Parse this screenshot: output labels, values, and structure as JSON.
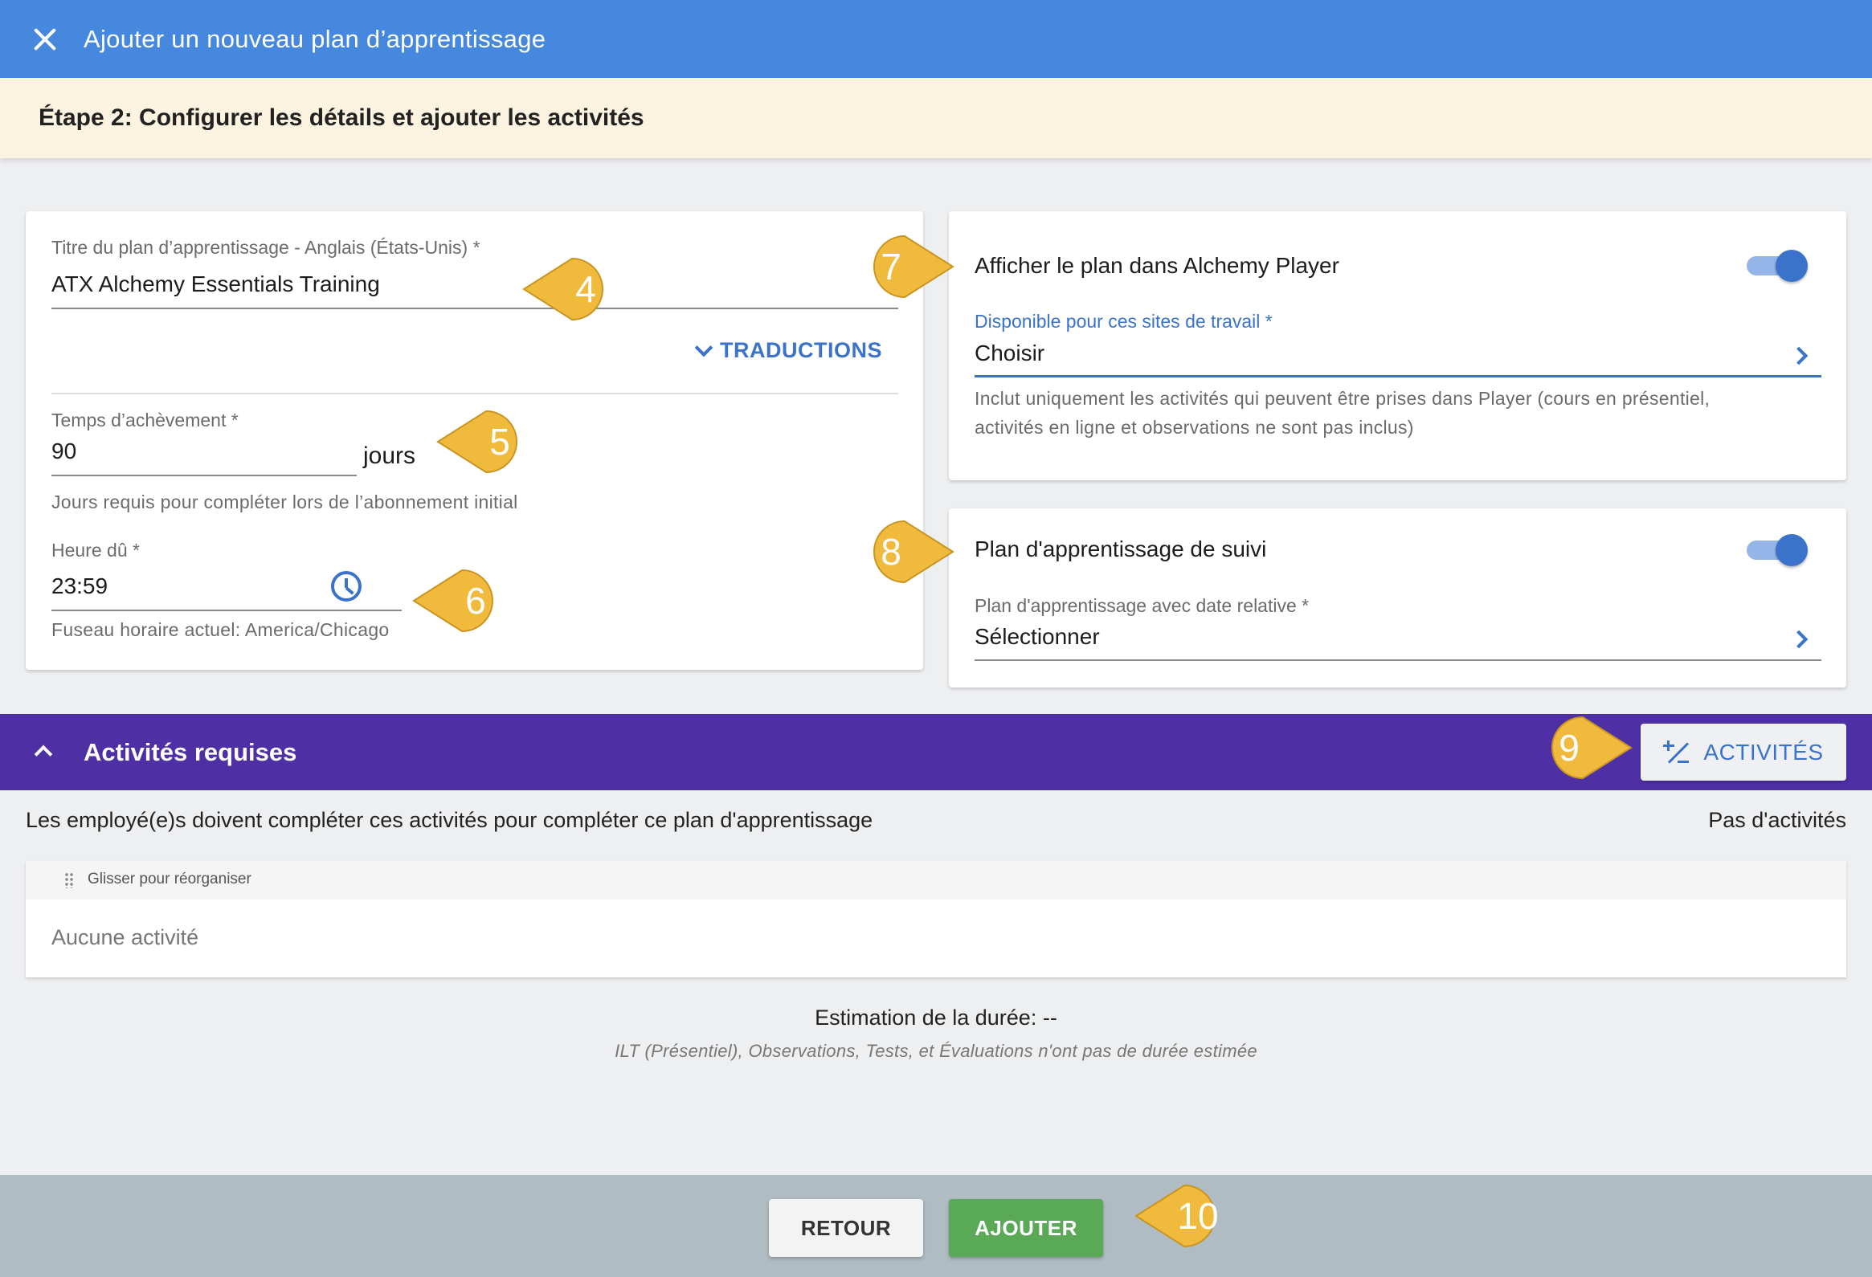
{
  "header": {
    "title": "Ajouter un nouveau plan d’apprentissage",
    "close_icon": "close-icon"
  },
  "step": {
    "text": "Étape 2: Configurer les détails et ajouter les activités"
  },
  "details": {
    "title_label": "Titre du plan d’apprentissage - Anglais (États-Unis) *",
    "title_value": "ATX Alchemy Essentials Training",
    "translations_label": "TRADUCTIONS",
    "completion_label": "Temps d’achèvement *",
    "completion_value": "90",
    "completion_unit": "jours",
    "completion_hint": "Jours requis pour compléter lors de l’abonnement initial",
    "due_label": "Heure dû *",
    "due_value": "23:59",
    "timezone_hint": "Fuseau horaire actuel: America/Chicago"
  },
  "player": {
    "title": "Afficher le plan dans Alchemy Player",
    "toggle_on": true,
    "sites_label": "Disponible pour ces sites de travail *",
    "sites_value": "Choisir",
    "hint_line1": "Inclut uniquement les activités qui peuvent être prises dans Player (cours en présentiel,",
    "hint_line2": "activités en ligne et observations ne sont pas inclus)"
  },
  "followup": {
    "title": "Plan d'apprentissage de suivi",
    "toggle_on": true,
    "plan_label": "Plan d'apprentissage avec date relative *",
    "plan_value": "Sélectionner"
  },
  "activities": {
    "section_title": "Activités requises",
    "add_button": "ACTIVITÉS",
    "description": "Les employé(e)s doivent compléter ces activités pour compléter ce plan d'apprentissage",
    "count_text": "Pas d'activités",
    "drag_hint": "Glisser pour réorganiser",
    "empty_text": "Aucune activité",
    "estimate": "Estimation de la durée: --",
    "estimate_note": "ILT (Présentiel), Observations, Tests, et Évaluations n'ont pas de durée estimée"
  },
  "footer": {
    "back_label": "RETOUR",
    "add_label": "AJOUTER"
  },
  "callouts": {
    "c4": "4",
    "c5": "5",
    "c6": "6",
    "c7": "7",
    "c8": "8",
    "c9": "9",
    "c10": "10"
  },
  "colors": {
    "header": "#4688de",
    "step_bar": "#fdf3e1",
    "section_bar": "#4e2fa4",
    "accent": "#3a73c9",
    "add_button": "#5aa957",
    "callout": "#f0bb3c"
  }
}
